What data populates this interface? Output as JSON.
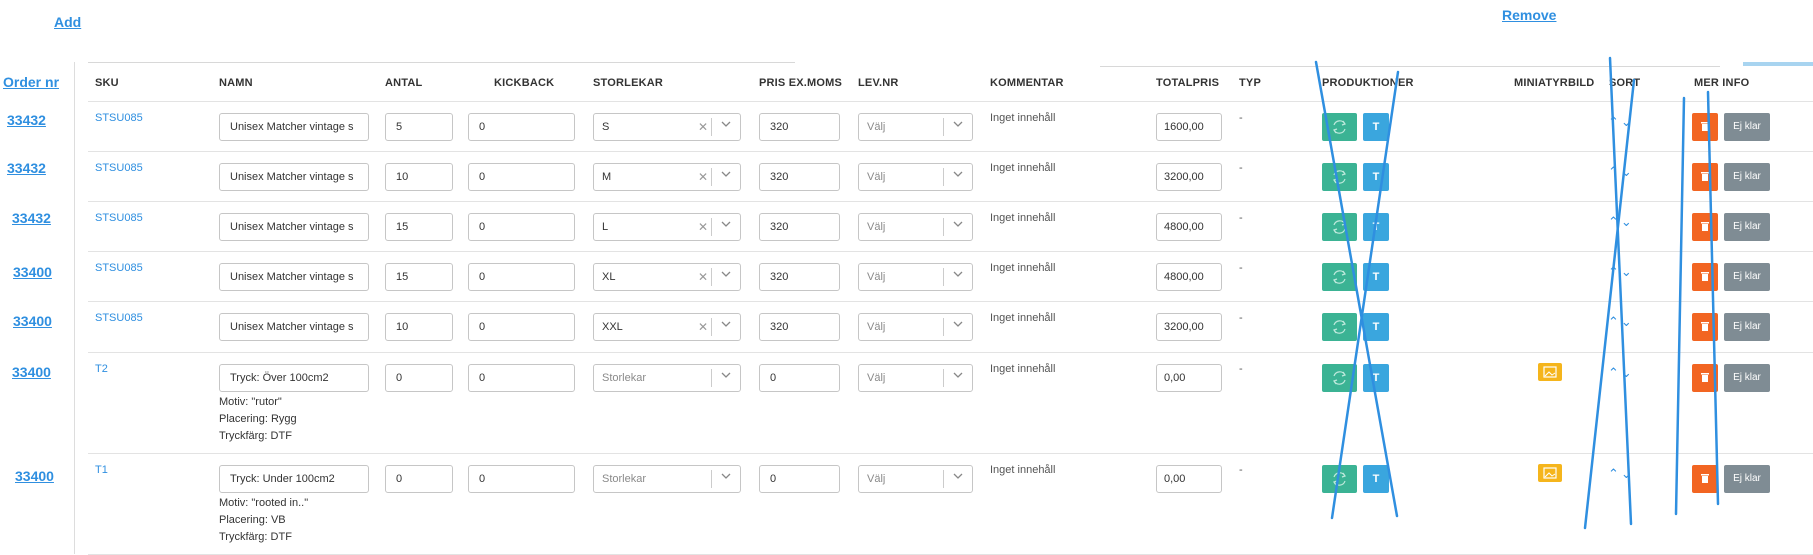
{
  "annotations": {
    "add": "Add",
    "remove": "Remove",
    "order_nr": "Order nr"
  },
  "headers": {
    "sku": "SKU",
    "namn": "NAMN",
    "antal": "ANTAL",
    "kickback": "KICKBACK",
    "storlekar": "STORLEKAR",
    "pris": "PRIS EX.MOMS",
    "levnr": "LEV.NR",
    "kommentar": "KOMMENTAR",
    "totalpris": "TOTALPRIS",
    "typ": "TYP",
    "produktioner": "PRODUKTIONER",
    "miniatyrbild": "MINIATYRBILD",
    "sort": "SORT",
    "merinfo": "MER INFO"
  },
  "rows": [
    {
      "order": "33432",
      "sku": "STSU085",
      "namn": "Unisex Matcher vintage s",
      "antal": "5",
      "kickback": "0",
      "storlek": "S",
      "pris": "320",
      "lev": "Välj",
      "kommentar": "Inget innehåll",
      "total": "1600,00",
      "typ": "-",
      "t_label": "T",
      "status": "Ej klar"
    },
    {
      "order": "33432",
      "sku": "STSU085",
      "namn": "Unisex Matcher vintage s",
      "antal": "10",
      "kickback": "0",
      "storlek": "M",
      "pris": "320",
      "lev": "Välj",
      "kommentar": "Inget innehåll",
      "total": "3200,00",
      "typ": "-",
      "t_label": "T",
      "status": "Ej klar"
    },
    {
      "order": "33432",
      "sku": "STSU085",
      "namn": "Unisex Matcher vintage s",
      "antal": "15",
      "kickback": "0",
      "storlek": "L",
      "pris": "320",
      "lev": "Välj",
      "kommentar": "Inget innehåll",
      "total": "4800,00",
      "typ": "-",
      "t_label": "T",
      "status": "Ej klar"
    },
    {
      "order": "33400",
      "sku": "STSU085",
      "namn": "Unisex Matcher vintage s",
      "antal": "15",
      "kickback": "0",
      "storlek": "XL",
      "pris": "320",
      "lev": "Välj",
      "kommentar": "Inget innehåll",
      "total": "4800,00",
      "typ": "-",
      "t_label": "T",
      "status": "Ej klar"
    },
    {
      "order": "33400",
      "sku": "STSU085",
      "namn": "Unisex Matcher vintage s",
      "antal": "10",
      "kickback": "0",
      "storlek": "XXL",
      "pris": "320",
      "lev": "Välj",
      "kommentar": "Inget innehåll",
      "total": "3200,00",
      "typ": "-",
      "t_label": "T",
      "status": "Ej klar"
    },
    {
      "order": "33400",
      "sku": "T2",
      "namn": "Tryck: Över 100cm2",
      "antal": "0",
      "kickback": "0",
      "storlek_placeholder": "Storlekar",
      "pris": "0",
      "lev": "Välj",
      "kommentar": "Inget innehåll",
      "total": "0,00",
      "typ": "-",
      "t_label": "T",
      "status": "Ej klar",
      "motiv": "Motiv: \"rutor\"",
      "placering": "Placering: Rygg",
      "tryckfarg": "Tryckfärg: DTF"
    },
    {
      "order": "33400",
      "sku": "T1",
      "namn": "Tryck: Under 100cm2",
      "antal": "0",
      "kickback": "0",
      "storlek_placeholder": "Storlekar",
      "pris": "0",
      "lev": "Välj",
      "kommentar": "Inget innehåll",
      "total": "0,00",
      "typ": "-",
      "t_label": "T",
      "status": "Ej klar",
      "motiv": "Motiv: \"rooted in..\"",
      "placering": "Placering: VB",
      "tryckfarg": "Tryckfärg: DTF"
    }
  ],
  "colors": {
    "accent": "#2f8fe0",
    "green": "#3bb394",
    "blue": "#3aa6de",
    "orange": "#f26522",
    "grey": "#7f8c94",
    "thumb": "#f5b51c"
  }
}
